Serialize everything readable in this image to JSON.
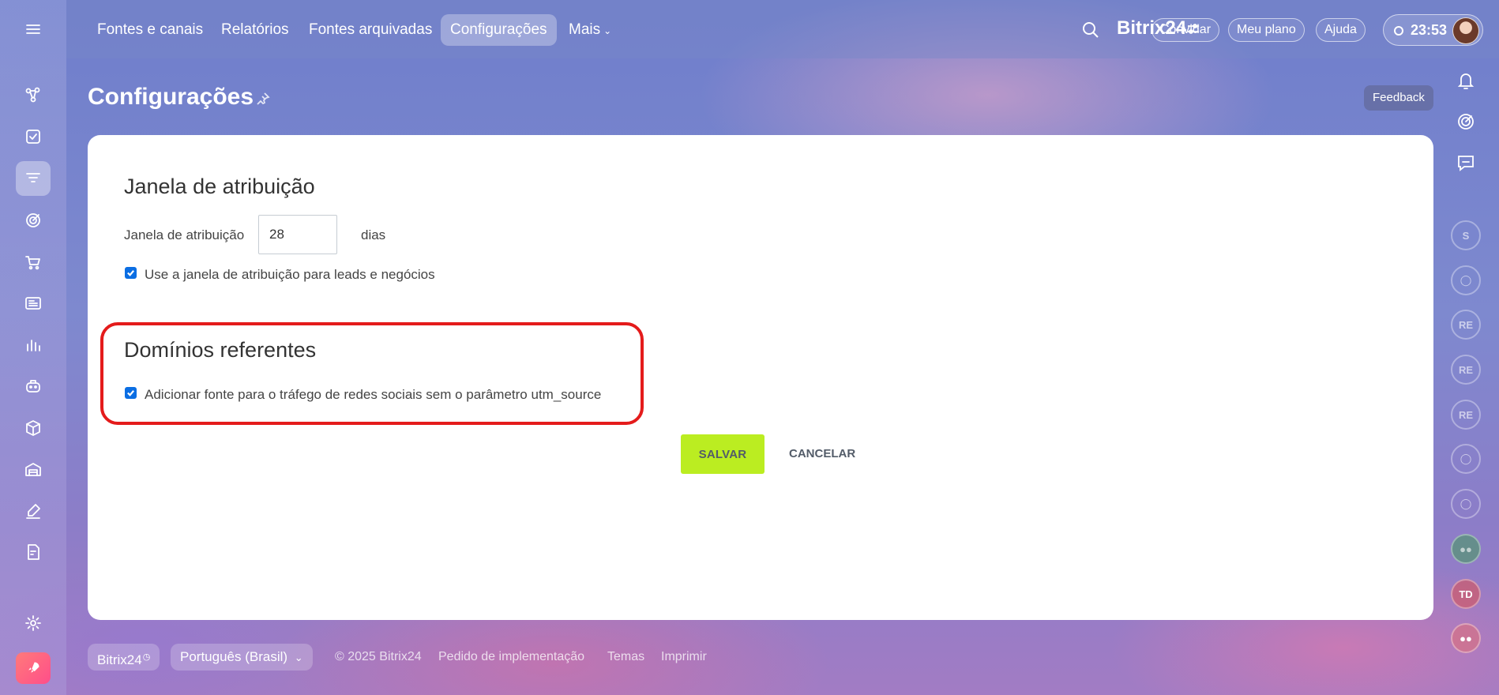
{
  "header": {
    "tabs": [
      {
        "label": "Fontes e canais"
      },
      {
        "label": "Relatórios"
      },
      {
        "label": "Fontes arquivadas"
      },
      {
        "label": "Configurações",
        "active": true
      },
      {
        "label": "Mais"
      }
    ],
    "brand": "Bitrix24",
    "invite_label": "Convidar",
    "plan_label": "Meu plano",
    "help_label": "Ajuda",
    "time": "23:53"
  },
  "right_rail": {
    "feedback_label": "Feedback",
    "avatars": [
      "S",
      "RE",
      "RE",
      "RE",
      "TD"
    ]
  },
  "page": {
    "title": "Configurações"
  },
  "attribution": {
    "section_title": "Janela de atribuição",
    "field_label": "Janela de atribuição",
    "field_value": "28",
    "unit": "dias",
    "checkbox_label": "Use a janela de atribuição para leads e negócios",
    "checkbox_checked": true
  },
  "referrers": {
    "section_title": "Domínios referentes",
    "checkbox_label": "Adicionar fonte para o tráfego de redes sociais sem o parâmetro utm_source",
    "checkbox_checked": true
  },
  "actions": {
    "save_label": "SALVAR",
    "cancel_label": "CANCELAR"
  },
  "footer": {
    "brand": "Bitrix24",
    "language": "Português (Brasil)",
    "copyright": "© 2025 Bitrix24",
    "links": [
      "Pedido de implementação",
      "Temas",
      "Imprimir"
    ]
  },
  "colors": {
    "save_button": "#bbed21",
    "highlight_border": "#e41b1b",
    "checkbox": "#0b6ee3"
  },
  "icons": {
    "sidebar": [
      "menu-icon",
      "crm-icon",
      "tasks-icon",
      "analytics-icon",
      "marketing-icon",
      "shop-icon",
      "sites-icon",
      "reports-icon",
      "bot-icon",
      "inventory-icon",
      "warehouse-icon",
      "sign-icon",
      "docs-icon",
      "settings-icon",
      "rocket-icon"
    ]
  }
}
